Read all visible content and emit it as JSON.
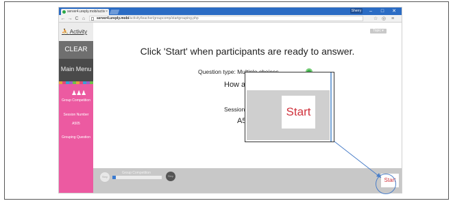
{
  "browser": {
    "tab_title": "server4.ureply.mobi/activ",
    "tab_close": "×",
    "user_badge": "Sherry",
    "controls": {
      "minimize": "–",
      "maximize": "□",
      "close": "✕"
    },
    "url_host": "server4.ureply.mobi",
    "url_path": "/activity/teacher/groupcomp/startgrouping.php",
    "nav": {
      "back": "←",
      "forward": "→",
      "reload": "C",
      "home": "⌂"
    },
    "addr_right": {
      "star": "☆",
      "ext": "◎",
      "menu": "≡"
    }
  },
  "sidebar": {
    "activity_label": "Activity",
    "clear_label": "CLEAR",
    "main_menu_label": "Main Menu",
    "group_competition_label": "Group Competition",
    "session_number_label": "Session Number",
    "session_number_value": "A505",
    "grouping_question_label": "Grouping Question"
  },
  "main": {
    "topic_button": "Topic",
    "headline": "Click 'Start' when participants are ready to answer.",
    "question_type": "Question type: Multiple choices",
    "question_partial": "How a",
    "session_partial": "Session",
    "session_value_partial": "A5"
  },
  "zoom": {
    "start_label": "Start"
  },
  "bottombar": {
    "step1_label": "Step",
    "progress_label": "Group Competition",
    "progress_fraction": 0.07,
    "step2_label": "Step",
    "start_label": "Start"
  }
}
